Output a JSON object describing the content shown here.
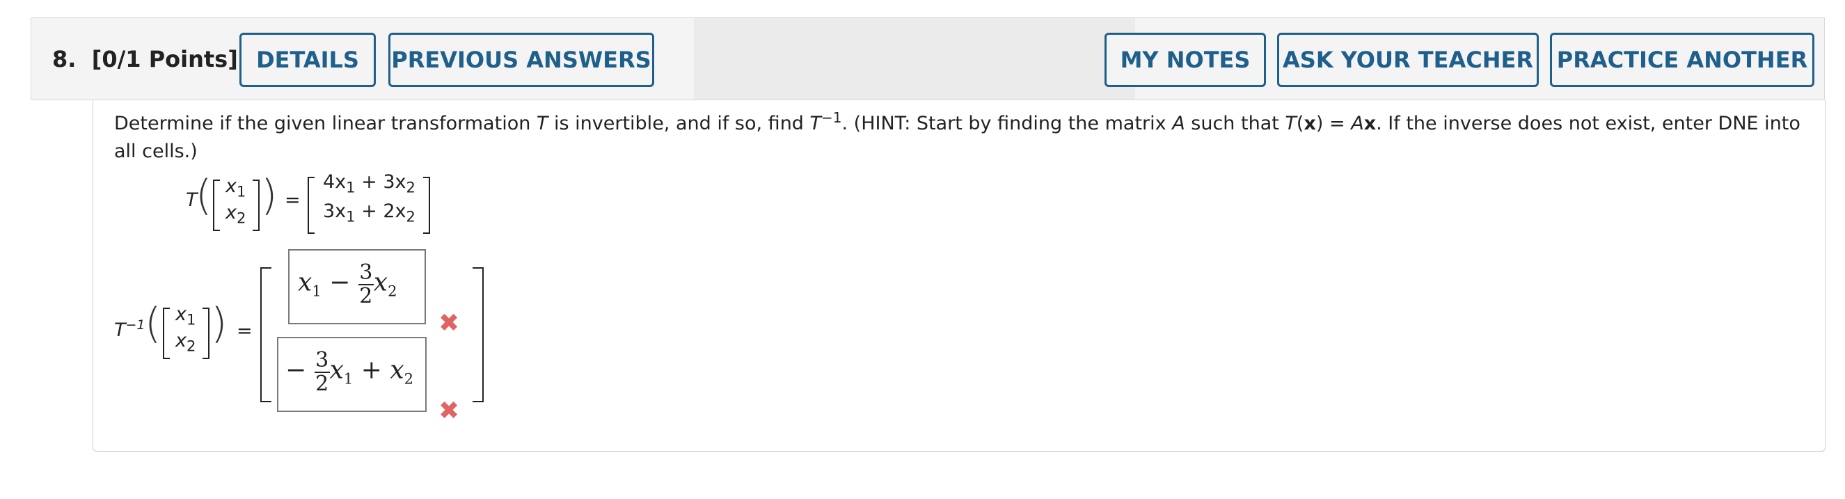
{
  "header": {
    "question_number": "8.",
    "points": "[0/1 Points]",
    "buttons": {
      "details": "DETAILS",
      "previous_answers": "PREVIOUS ANSWERS",
      "my_notes": "MY NOTES",
      "ask_teacher": "ASK YOUR TEACHER",
      "practice_another": "PRACTICE ANOTHER"
    }
  },
  "question": {
    "part1": "Determine if the given linear transformation ",
    "T": "T",
    "part2": " is invertible, and if so, find ",
    "T_inv_base": "T",
    "T_inv_exp": "−1",
    "part3": ". (HINT: Start by finding the matrix ",
    "A": "A",
    "part4": " such that ",
    "Tx_T": "T",
    "Tx_open": "(",
    "Tx_x": "x",
    "Tx_close": ") = ",
    "Ax_A": "A",
    "Ax_x": "x",
    "part5": ". If the inverse does not exist, enter DNE into all cells.)"
  },
  "transform": {
    "T": "T",
    "x1": "x",
    "x1_sub": "1",
    "x2": "x",
    "x2_sub": "2",
    "equals": "=",
    "row1": {
      "c1": "4x",
      "s1": "1",
      "op": " + 3x",
      "s2": "2"
    },
    "row2": {
      "c1": "3x",
      "s1": "1",
      "op": " + 2x",
      "s2": "2"
    }
  },
  "inverse": {
    "T": "T",
    "exp": "−1",
    "x1": "x",
    "x1_sub": "1",
    "x2": "x",
    "x2_sub": "2",
    "equals": "=",
    "answer1": {
      "a": "x",
      "a_sub": "1",
      "minus": " − ",
      "num": "3",
      "den": "2",
      "b": "x",
      "b_sub": "2"
    },
    "answer2": {
      "minus": "− ",
      "num": "3",
      "den": "2",
      "a": "x",
      "a_sub": "1",
      "plus": " + ",
      "b": "x",
      "b_sub": "2"
    },
    "status1": "✖",
    "status2": "✖"
  },
  "colors": {
    "accent": "#1f5f8b",
    "incorrect": "#e06464"
  }
}
